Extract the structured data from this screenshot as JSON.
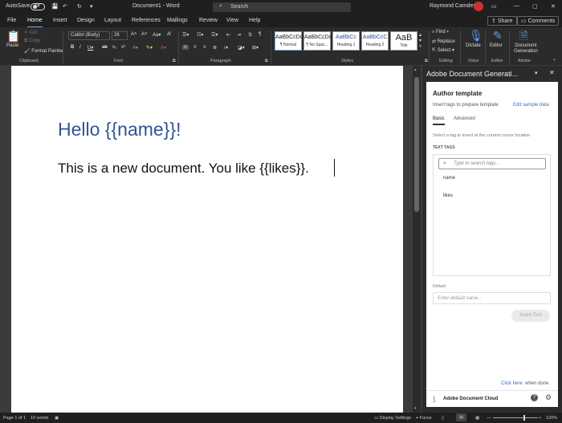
{
  "titlebar": {
    "autosave": "AutoSave",
    "autosave_state": "Off",
    "doc_title": "Document1 - Word",
    "search_placeholder": "Search",
    "user": "Raymond Camden"
  },
  "menu": {
    "items": [
      "File",
      "Home",
      "Insert",
      "Design",
      "Layout",
      "References",
      "Mailings",
      "Review",
      "View",
      "Help"
    ],
    "active": "Home",
    "share": "Share",
    "comments": "Comments"
  },
  "ribbon": {
    "clipboard": {
      "paste": "Paste",
      "cut": "Cut",
      "copy": "Copy",
      "format_painter": "Format Painter",
      "label": "Clipboard"
    },
    "font": {
      "name": "Calibri (Body)",
      "size": "26",
      "label": "Font"
    },
    "paragraph": {
      "label": "Paragraph"
    },
    "styles": {
      "label": "Styles",
      "items": [
        {
          "sample": "AaBbCcDc",
          "name": "¶ Normal"
        },
        {
          "sample": "AaBbCcDc",
          "name": "¶ No Spac..."
        },
        {
          "sample": "AaBbCc",
          "name": "Heading 1"
        },
        {
          "sample": "AaBbCcC",
          "name": "Heading 2"
        },
        {
          "sample": "AaB",
          "name": "Title"
        }
      ]
    },
    "editing": {
      "find": "Find",
      "replace": "Replace",
      "select": "Select",
      "label": "Editing"
    },
    "voice": {
      "dictate": "Dictate",
      "label": "Voice"
    },
    "editor": {
      "editor": "Editor",
      "label": "Editor"
    },
    "adobe": {
      "docgen": "Document Generation",
      "label": "Adobe"
    }
  },
  "document": {
    "heading": "Hello {{name}}!",
    "body": "This is a new document. You like {{likes}}."
  },
  "pane": {
    "title": "Adobe Document Generati...",
    "section_title": "Author template",
    "subtitle": "Insert tags to prepare template",
    "edit_link": "Edit sample data",
    "tabs": [
      "Basic",
      "Advanced"
    ],
    "instruction": "Select a tag to insert at the current cursor location",
    "text_tags_label": "TEXT TAGS",
    "search_placeholder": "Type to search tags...",
    "tags": [
      "name",
      "likes"
    ],
    "default_label": "Default",
    "default_placeholder": "Enter default value...",
    "insert_button": "Insert Text",
    "click_here": "Click here",
    "when_done": "when done",
    "footer_brand": "Adobe Document Cloud"
  },
  "status": {
    "page": "Page 1 of 1",
    "words": "10 words",
    "display_settings": "Display Settings",
    "focus": "Focus",
    "zoom": "120%"
  },
  "colors": {
    "heading": "#2f5496",
    "link": "#2d6fd6",
    "accent": "#7fa6e0"
  }
}
